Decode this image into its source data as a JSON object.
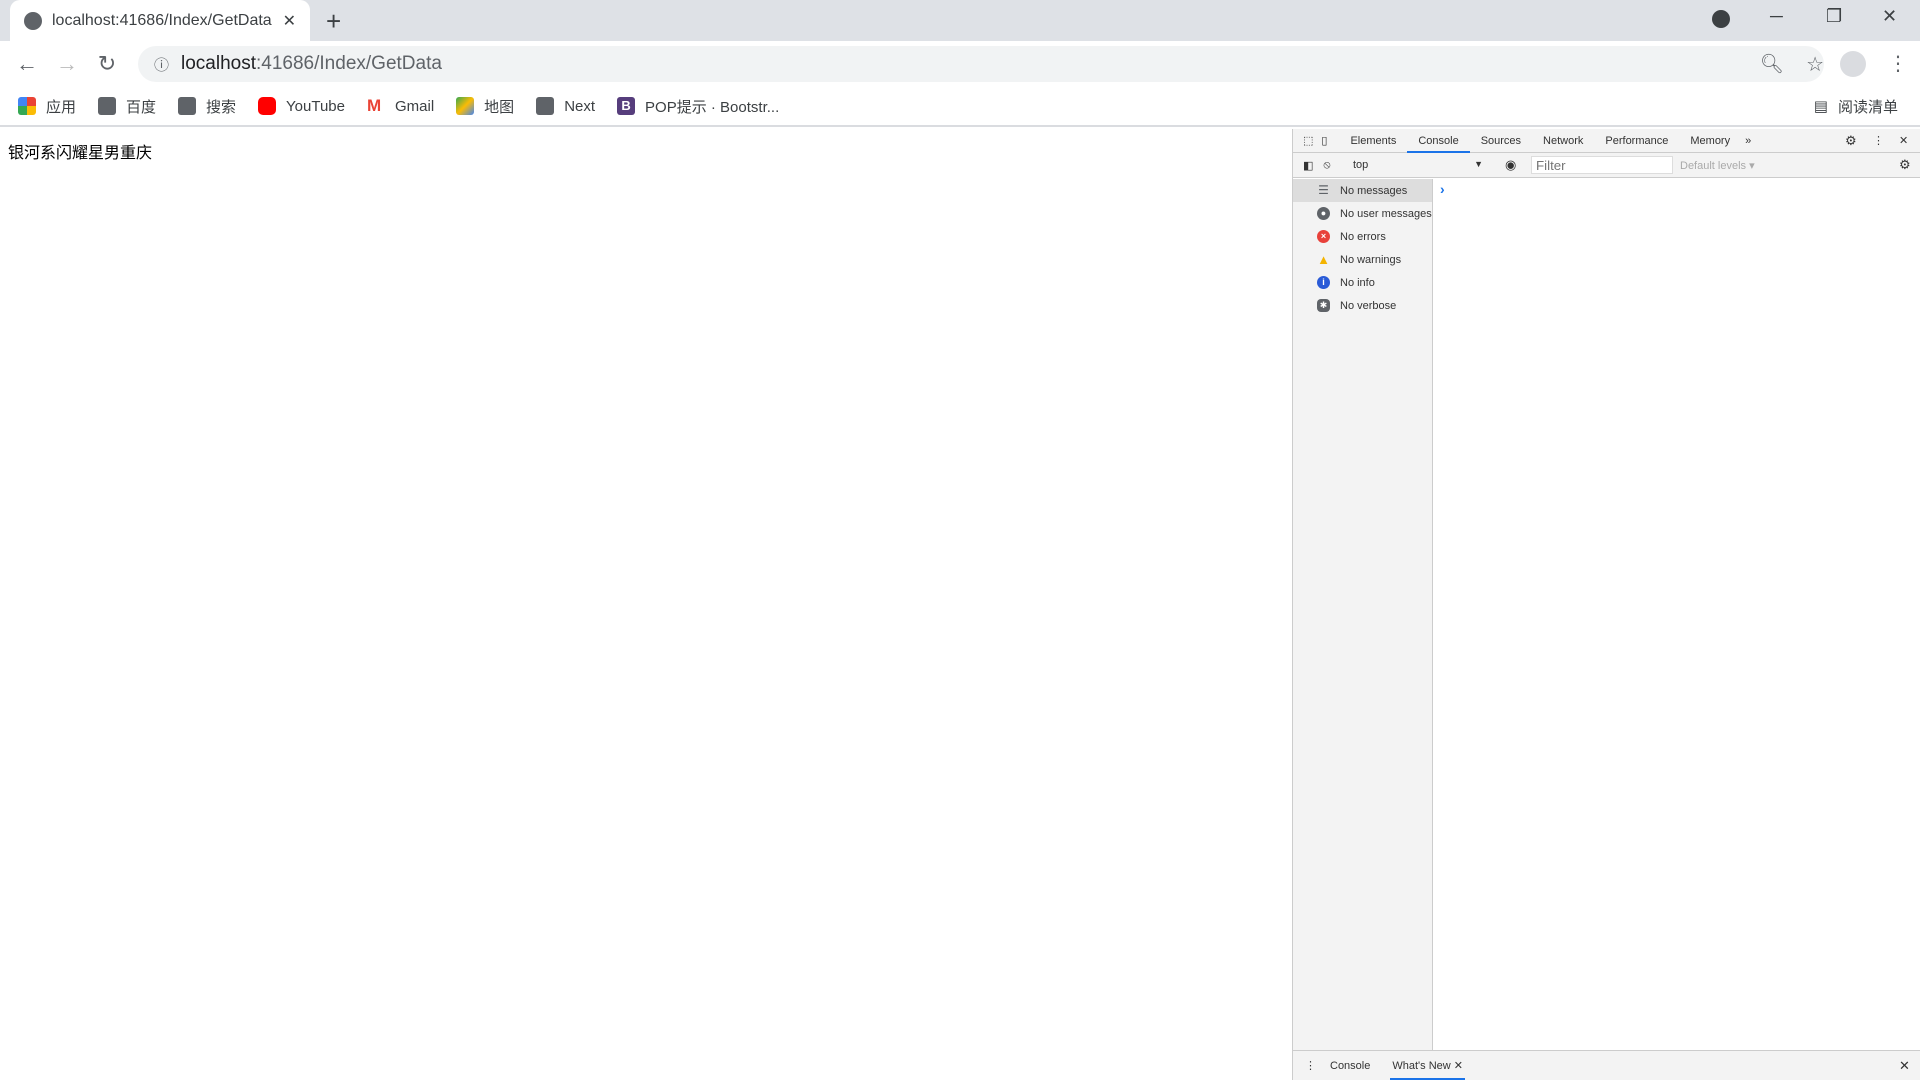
{
  "browser": {
    "tab_title": "localhost:41686/Index/GetData",
    "url_host": "localhost",
    "url_path": ":41686/Index/GetData",
    "bookmarks": [
      {
        "label": "应用",
        "icon": "apps-icon"
      },
      {
        "label": "百度",
        "icon": "globe-icon"
      },
      {
        "label": "搜索",
        "icon": "globe-icon"
      },
      {
        "label": "YouTube",
        "icon": "youtube-icon"
      },
      {
        "label": "Gmail",
        "icon": "gmail-icon"
      },
      {
        "label": "地图",
        "icon": "maps-icon"
      },
      {
        "label": "Next",
        "icon": "globe-icon"
      },
      {
        "label": "POP提示 · Bootstr...",
        "icon": "bootstrap-icon"
      }
    ],
    "reading_list": "阅读清单"
  },
  "page": {
    "text": "银河系闪耀星男重庆"
  },
  "devtools": {
    "tabs": [
      "Elements",
      "Console",
      "Sources",
      "Network",
      "Performance",
      "Memory"
    ],
    "active_tab": "Console",
    "context": "top",
    "filter_placeholder": "Filter",
    "levels": "Default levels ▾",
    "sidebar": [
      {
        "label": "No messages",
        "color": "#5f6368"
      },
      {
        "label": "No user messages",
        "color": "#5f6368"
      },
      {
        "label": "No errors",
        "color": "#e8413a"
      },
      {
        "label": "No warnings",
        "color": "#f4b400"
      },
      {
        "label": "No info",
        "color": "#2a5bd7"
      },
      {
        "label": "No verbose",
        "color": "#5f6368"
      }
    ],
    "prompt": "›",
    "drawer_tabs": [
      "Console",
      "What's New"
    ]
  }
}
